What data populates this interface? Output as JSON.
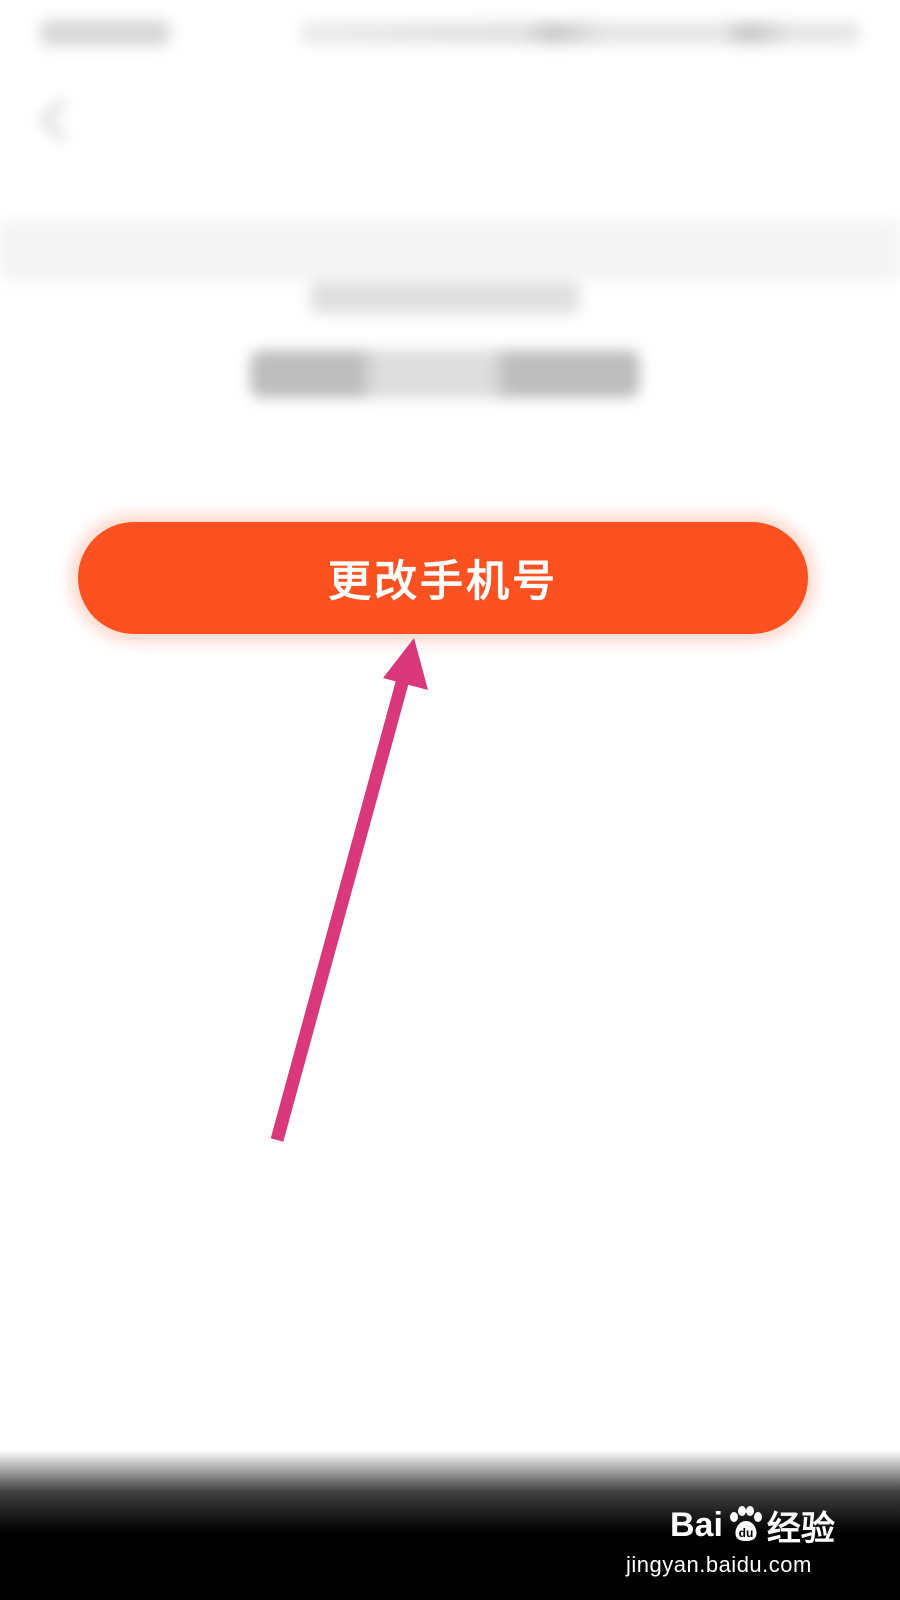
{
  "screen": {
    "background": "#ffffff"
  },
  "primary_button": {
    "label": "更改手机号",
    "color": "#fe5121",
    "text_color": "#ffffff"
  },
  "annotation": {
    "arrow_color": "#d9387a"
  },
  "watermark": {
    "logo_prefix": "Bai",
    "logo_suffix": "经验",
    "icon": "paw-icon",
    "url": "jingyan.baidu.com"
  }
}
